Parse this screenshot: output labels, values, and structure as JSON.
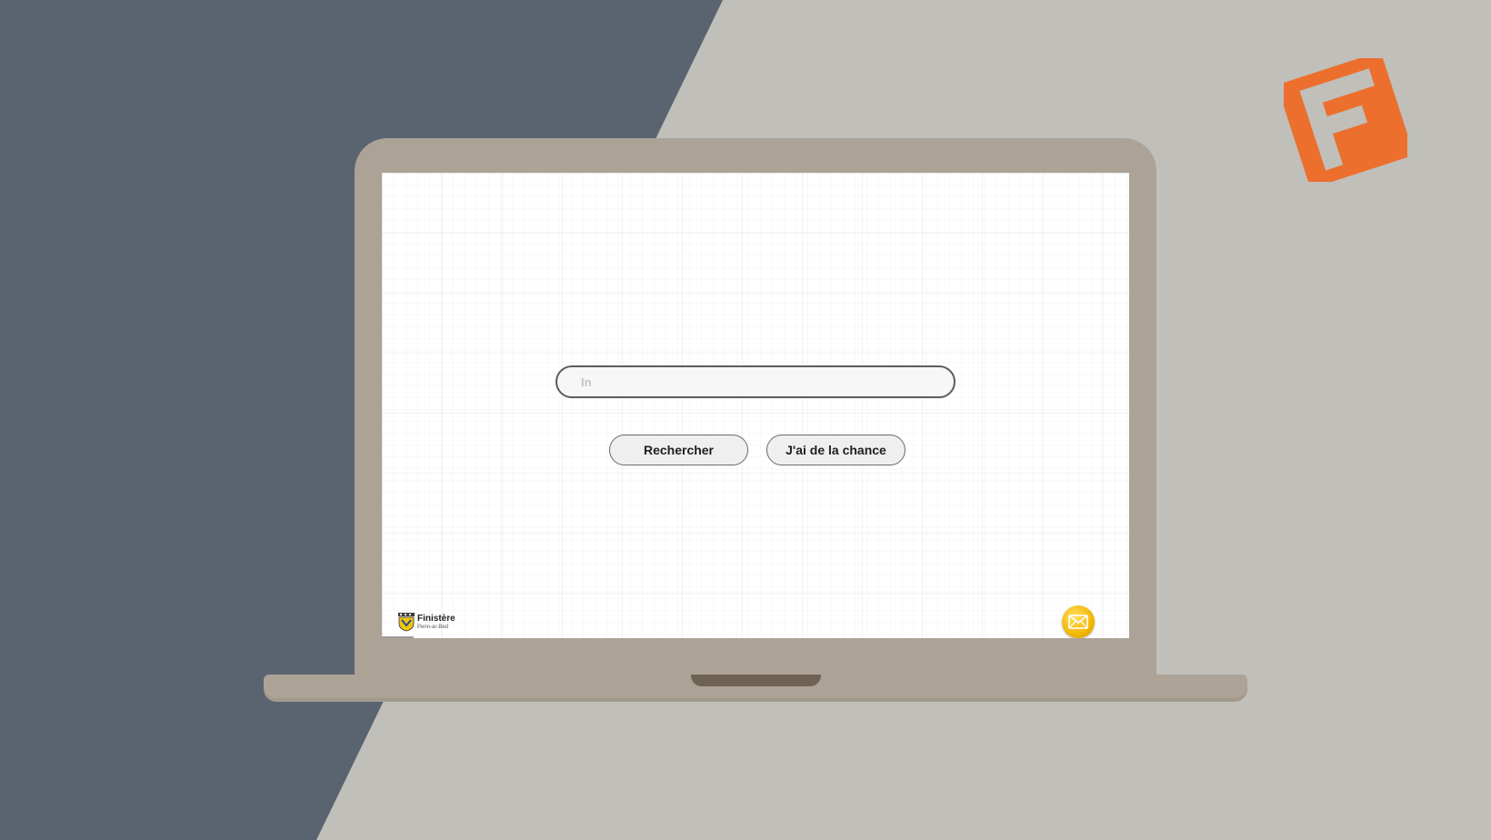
{
  "background": {
    "left_color": "#5a6470",
    "right_color": "#c0bfba"
  },
  "corner_logo": {
    "icon": "finistere-f-logo-icon",
    "color": "#ec6f2d"
  },
  "laptop": {
    "frame_color": "#aca396",
    "notch_color": "#6e6254"
  },
  "search": {
    "input_value": "",
    "input_placeholder": "In",
    "search_button_label": "Rechercher",
    "lucky_button_label": "J'ai de la chance"
  },
  "footer": {
    "brand_logo": {
      "name": "Finistère",
      "subtitle": "Penn-ar-Bed",
      "icon": "finistere-crest-icon"
    },
    "contact_button": {
      "icon": "envelope-icon",
      "color": "#f2b705"
    }
  }
}
